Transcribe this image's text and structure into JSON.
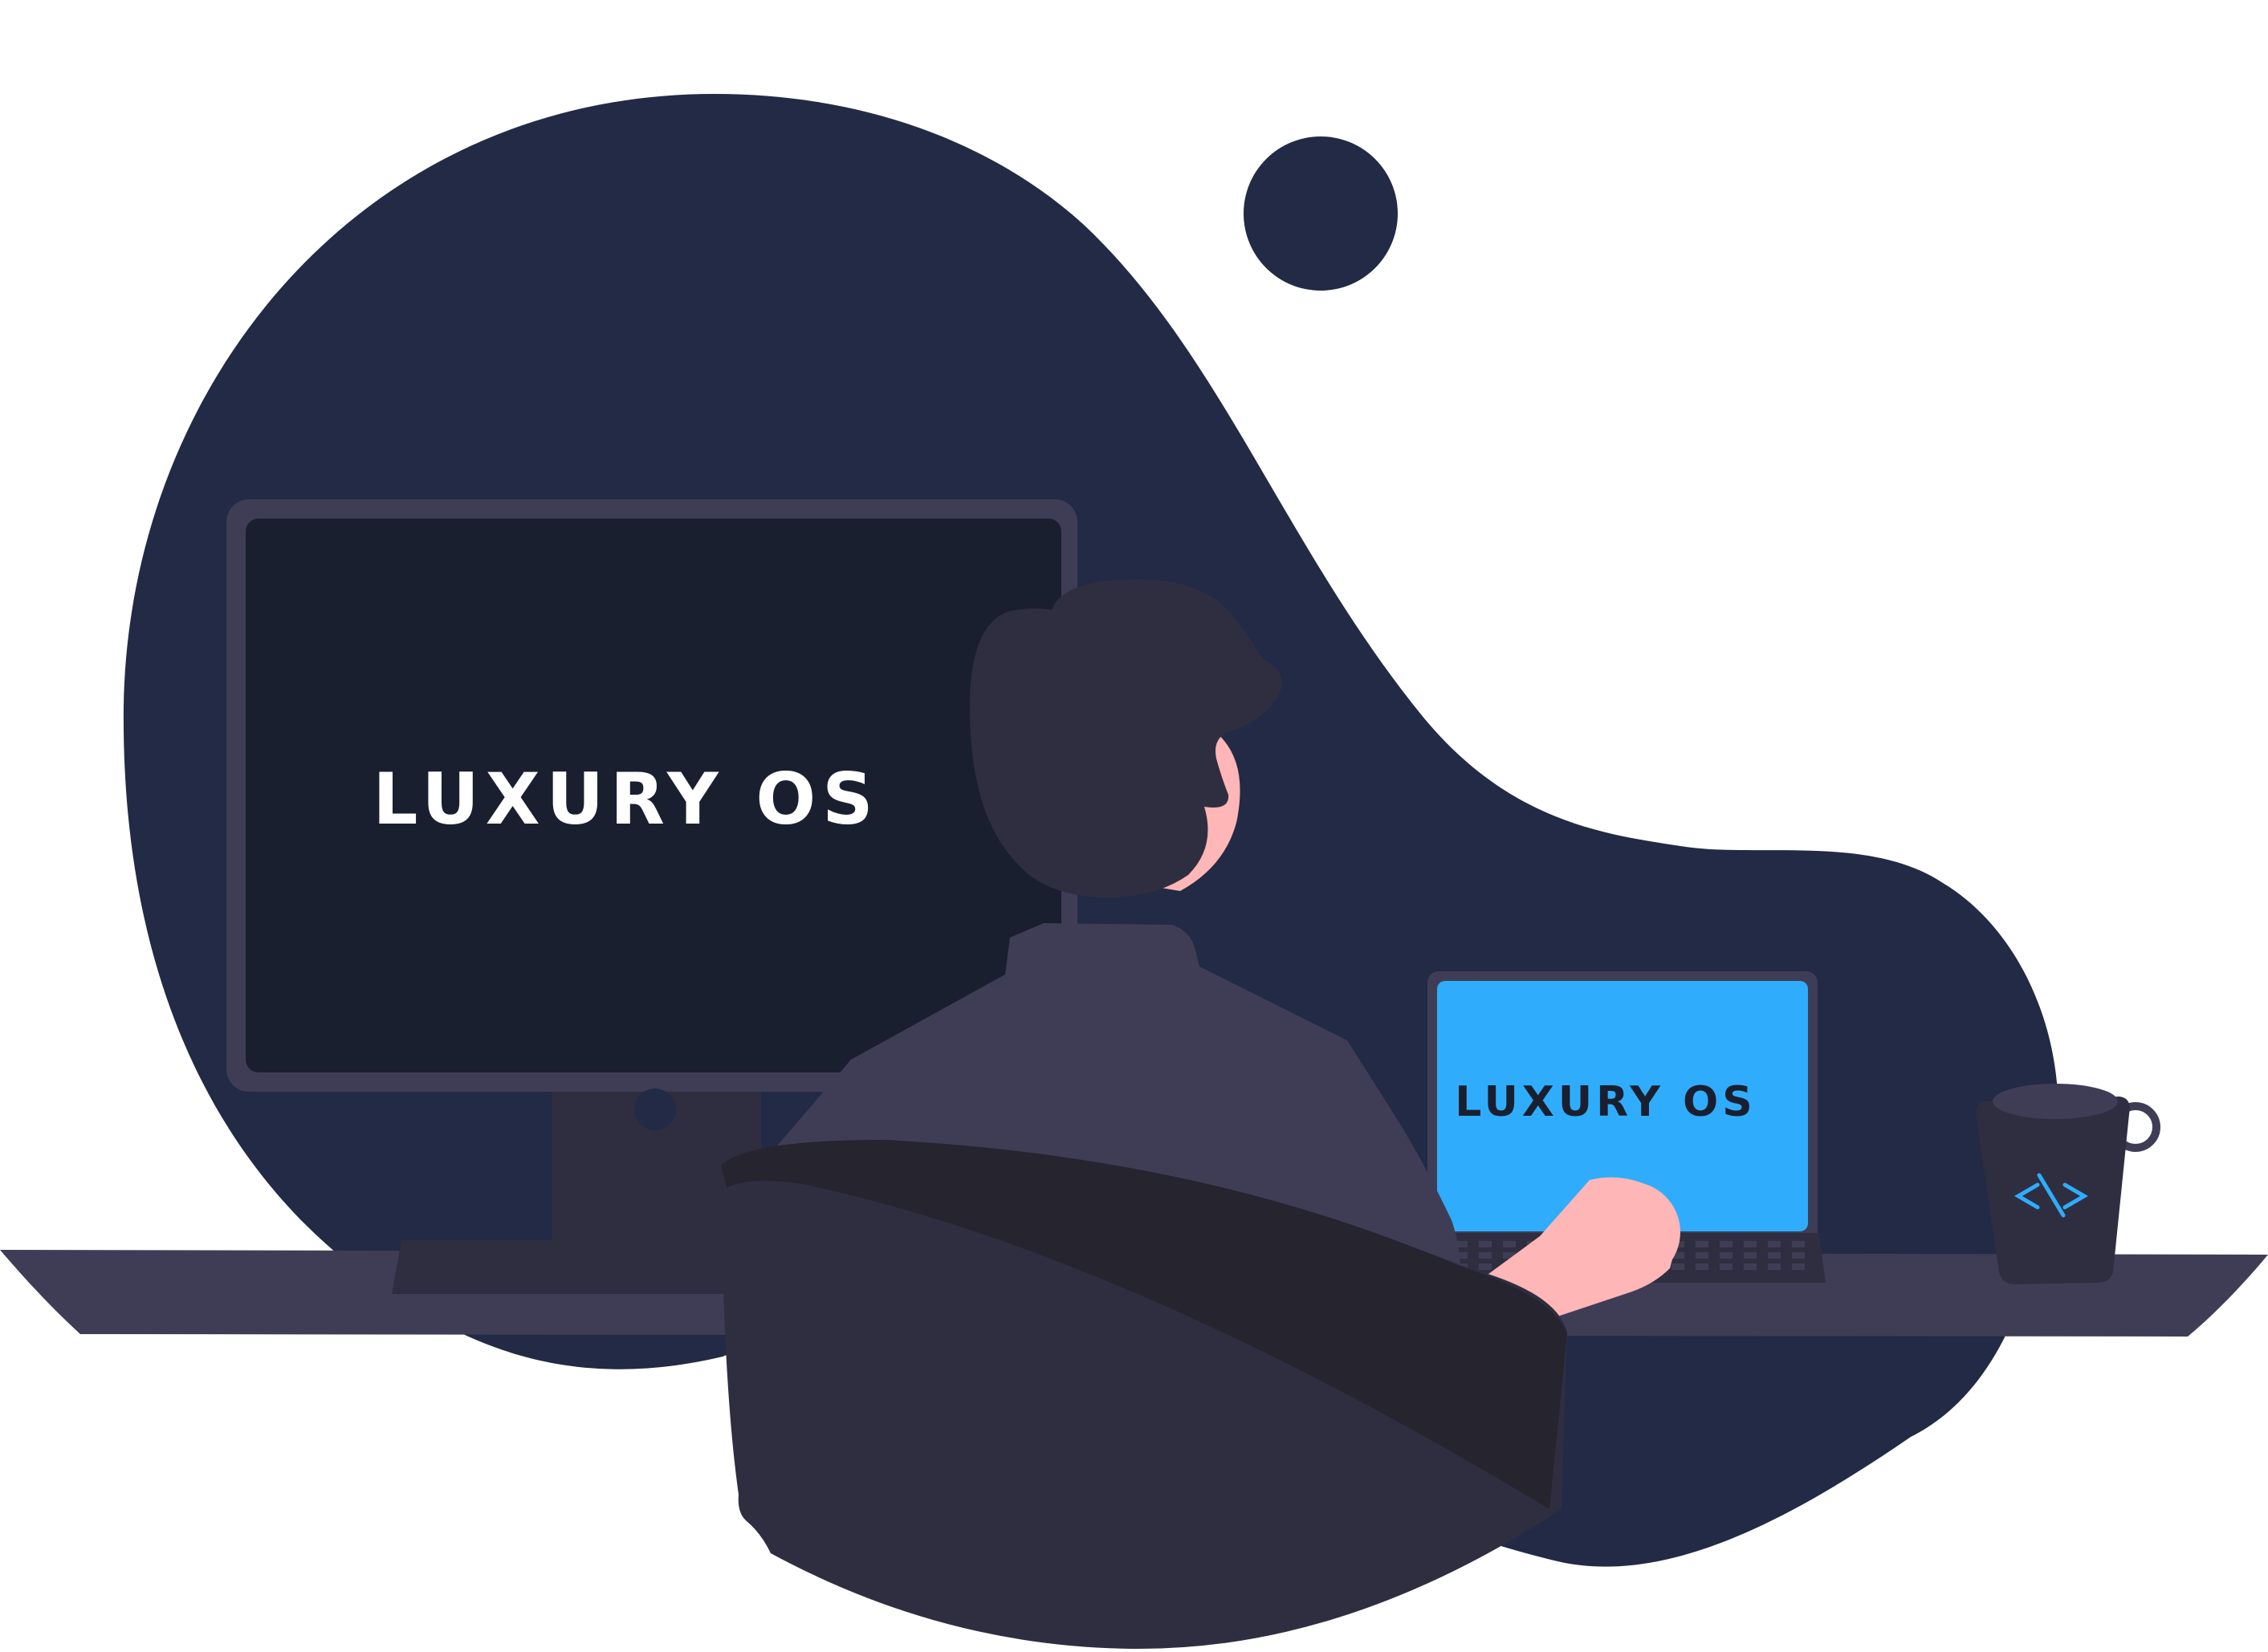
{
  "monitor": {
    "screen_text": "LUXURY OS"
  },
  "laptop": {
    "screen_text": "LUXURY OS"
  },
  "mug": {
    "icon": "code-brackets-icon"
  },
  "colors": {
    "background": "#ffffff",
    "blob": "#222a45",
    "monitor_frame": "#3f3d56",
    "monitor_screen": "#1a1f30",
    "laptop_screen": "#2fadfc",
    "laptop_text": "#1a1f30",
    "desk": "#3f3d56",
    "dark_clothing": "#2f2e41",
    "darker_clothing": "#25242f",
    "skin": "#ffb6b6",
    "code_icon": "#2fadfc"
  }
}
